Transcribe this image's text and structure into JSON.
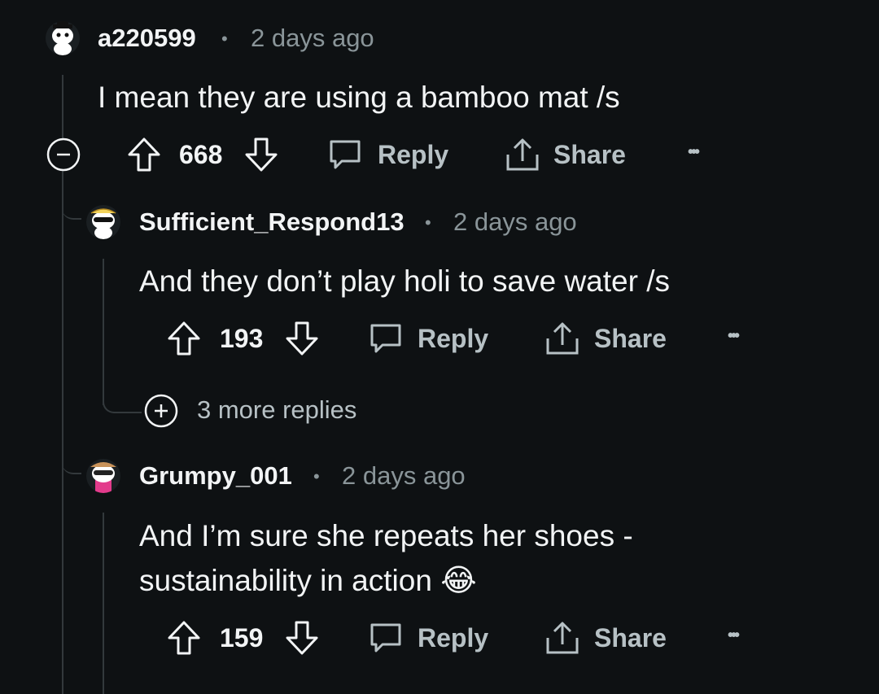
{
  "comments": [
    {
      "username": "a220599",
      "separator": "•",
      "time": "2 days ago",
      "body": "I mean they are using a bamboo mat /s",
      "votes": "668",
      "reply_label": "Reply",
      "share_label": "Share",
      "more_label": "•••"
    },
    {
      "username": "Sufficient_Respond13",
      "separator": "•",
      "time": "2 days ago",
      "body": "And they don’t play holi to save water /s",
      "votes": "193",
      "reply_label": "Reply",
      "share_label": "Share",
      "more_label": "•••",
      "more_replies": "3 more replies"
    },
    {
      "username": "Grumpy_001",
      "separator": "•",
      "time": "2 days ago",
      "body_line1": "And I’m sure she repeats her shoes -",
      "body_line2": "sustainability in action",
      "emoji": "😂",
      "votes": "159",
      "reply_label": "Reply",
      "share_label": "Share",
      "more_label": "•••"
    }
  ]
}
